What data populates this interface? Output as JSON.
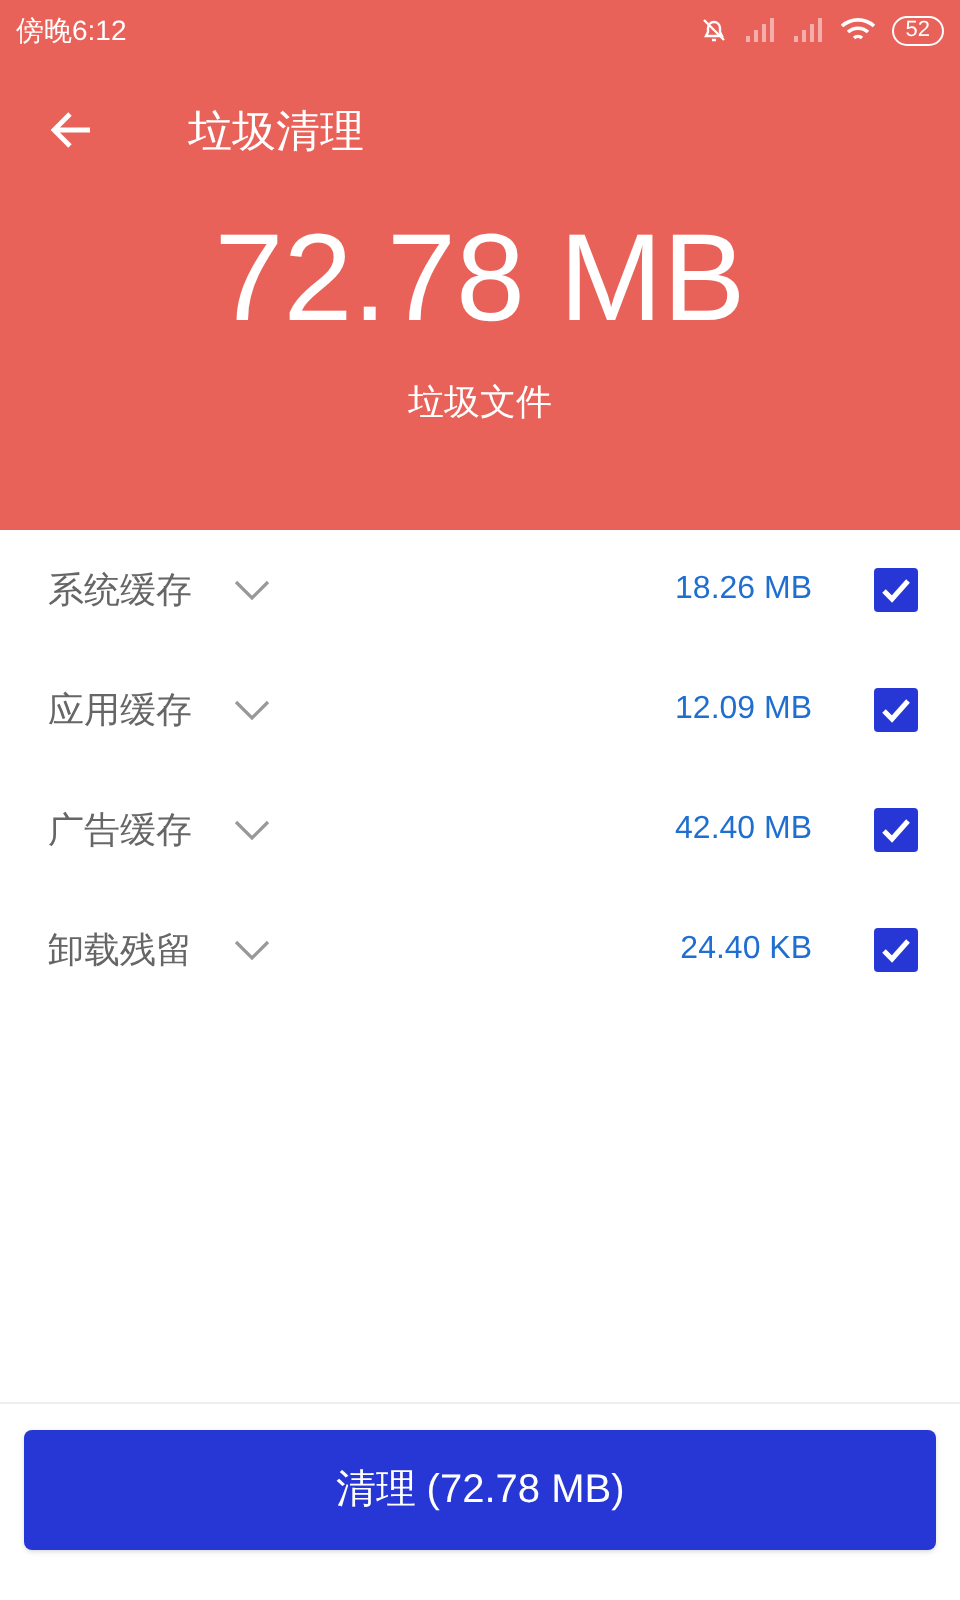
{
  "status_bar": {
    "time": "傍晚6:12",
    "battery": "52"
  },
  "header": {
    "title": "垃圾清理",
    "total": "72.78 MB",
    "caption": "垃圾文件"
  },
  "items": [
    {
      "label": "系统缓存",
      "size": "18.26 MB",
      "checked": true,
      "expanded": false
    },
    {
      "label": "应用缓存",
      "size": "12.09 MB",
      "checked": true,
      "expanded": false
    },
    {
      "label": "广告缓存",
      "size": "42.40 MB",
      "checked": true,
      "expanded": false
    },
    {
      "label": "卸载残留",
      "size": "24.40 KB",
      "checked": true,
      "expanded": false
    }
  ],
  "clean_button": "清理 (72.78 MB)"
}
